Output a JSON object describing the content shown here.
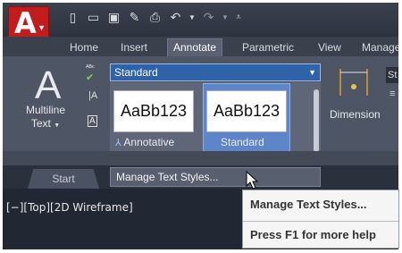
{
  "app": {
    "logo_letter": "A",
    "brand_color": "#c41c1c"
  },
  "qat": {
    "icons": [
      "new-icon",
      "open-icon",
      "save-icon",
      "saveas-icon",
      "plot-icon",
      "undo-icon",
      "redo-icon",
      "customize-icon"
    ]
  },
  "tabs": [
    {
      "label": "Home"
    },
    {
      "label": "Insert"
    },
    {
      "label": "Annotate",
      "active": true
    },
    {
      "label": "Parametric"
    },
    {
      "label": "View"
    },
    {
      "label": "Manage"
    }
  ],
  "ribbon": {
    "multiline_text": {
      "icon": "A",
      "label_line1": "Multiline",
      "label_line2": "Text"
    },
    "text_style_combo": {
      "value": "Standard"
    },
    "gallery": [
      {
        "preview": "AaBb123",
        "label": "Annotative"
      },
      {
        "preview": "AaBb123",
        "label": "Standard",
        "selected": true
      }
    ],
    "dimension": {
      "label": "Dimension"
    },
    "right_combo_partial": "St"
  },
  "menu": {
    "manage_text_styles": "Manage Text Styles..."
  },
  "file_tabs": [
    {
      "label": "Start"
    }
  ],
  "viewport": {
    "label": "[−][Top][2D Wireframe]"
  },
  "tooltip": {
    "title": "Manage Text Styles...",
    "footer": "Press F1 for more help"
  }
}
